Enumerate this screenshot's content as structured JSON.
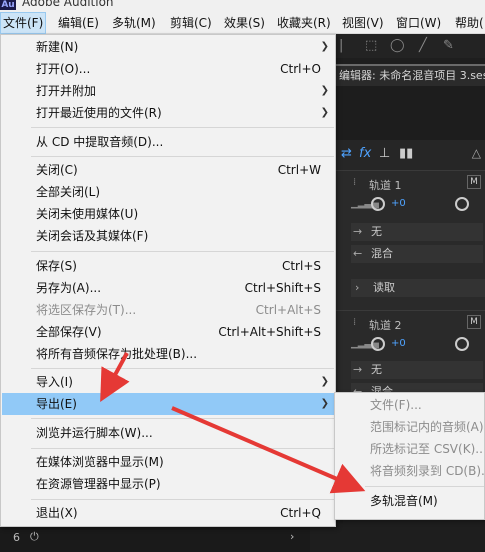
{
  "app": {
    "logo": "Au",
    "title": "Adobe Audition"
  },
  "menubar": [
    {
      "label": "文件(F)"
    },
    {
      "label": "编辑(E)"
    },
    {
      "label": "多轨(M)"
    },
    {
      "label": "剪辑(C)"
    },
    {
      "label": "效果(S)"
    },
    {
      "label": "收藏夹(R)"
    },
    {
      "label": "视图(V)"
    },
    {
      "label": "窗口(W)"
    },
    {
      "label": "帮助("
    }
  ],
  "file_menu": {
    "items": [
      {
        "label": "新建(N)",
        "shortcut": "",
        "submenu": true,
        "disabled": false
      },
      {
        "label": "打开(O)...",
        "shortcut": "Ctrl+O",
        "submenu": false,
        "disabled": false
      },
      {
        "label": "打开并附加",
        "shortcut": "",
        "submenu": true,
        "disabled": false
      },
      {
        "label": "打开最近使用的文件(R)",
        "shortcut": "",
        "submenu": true,
        "disabled": false
      },
      {
        "label": "从 CD 中提取音频(D)...",
        "shortcut": "",
        "submenu": false,
        "disabled": false
      },
      {
        "label": "关闭(C)",
        "shortcut": "Ctrl+W",
        "submenu": false,
        "disabled": false
      },
      {
        "label": "全部关闭(L)",
        "shortcut": "",
        "submenu": false,
        "disabled": false
      },
      {
        "label": "关闭未使用媒体(U)",
        "shortcut": "",
        "submenu": false,
        "disabled": false
      },
      {
        "label": "关闭会话及其媒体(F)",
        "shortcut": "",
        "submenu": false,
        "disabled": false
      },
      {
        "label": "保存(S)",
        "shortcut": "Ctrl+S",
        "submenu": false,
        "disabled": false
      },
      {
        "label": "另存为(A)...",
        "shortcut": "Ctrl+Shift+S",
        "submenu": false,
        "disabled": false
      },
      {
        "label": "将选区保存为(T)...",
        "shortcut": "Ctrl+Alt+S",
        "submenu": false,
        "disabled": true
      },
      {
        "label": "全部保存(V)",
        "shortcut": "Ctrl+Alt+Shift+S",
        "submenu": false,
        "disabled": false
      },
      {
        "label": "将所有音频保存为批处理(B)...",
        "shortcut": "",
        "submenu": false,
        "disabled": false
      },
      {
        "label": "导入(I)",
        "shortcut": "",
        "submenu": true,
        "disabled": false
      },
      {
        "label": "导出(E)",
        "shortcut": "",
        "submenu": true,
        "disabled": false,
        "highlighted": true
      },
      {
        "label": "浏览并运行脚本(W)...",
        "shortcut": "",
        "submenu": false,
        "disabled": false
      },
      {
        "label": "在媒体浏览器中显示(M)",
        "shortcut": "",
        "submenu": false,
        "disabled": false
      },
      {
        "label": "在资源管理器中显示(P)",
        "shortcut": "",
        "submenu": false,
        "disabled": false
      },
      {
        "label": "退出(X)",
        "shortcut": "Ctrl+Q",
        "submenu": false,
        "disabled": false
      }
    ]
  },
  "export_submenu": {
    "items": [
      {
        "label": "文件(F)...",
        "disabled": true
      },
      {
        "label": "范围标记内的音频(A)...",
        "disabled": true
      },
      {
        "label": "所选标记至 CSV(K)...",
        "disabled": true
      },
      {
        "label": "将音频刻录到 CD(B)...",
        "disabled": true
      },
      {
        "label": "多轨混音(M)",
        "disabled": false
      }
    ]
  },
  "background": {
    "editor_tab": "编辑器: 未命名混音项目 3.ses",
    "fx_label": "fx",
    "track1": {
      "name": "轨道 1",
      "m_label": "M",
      "volume": "+0",
      "input": "无",
      "output": "混合"
    },
    "read_mode": "读取",
    "track2": {
      "name": "轨道 2",
      "m_label": "M",
      "volume": "+0",
      "input": "无",
      "output": "混合"
    },
    "bottom_track_number": "6"
  },
  "colors": {
    "highlight": "#91c9f7",
    "annotation_arrow": "#e53935",
    "accent_blue": "#4fa3ff"
  }
}
